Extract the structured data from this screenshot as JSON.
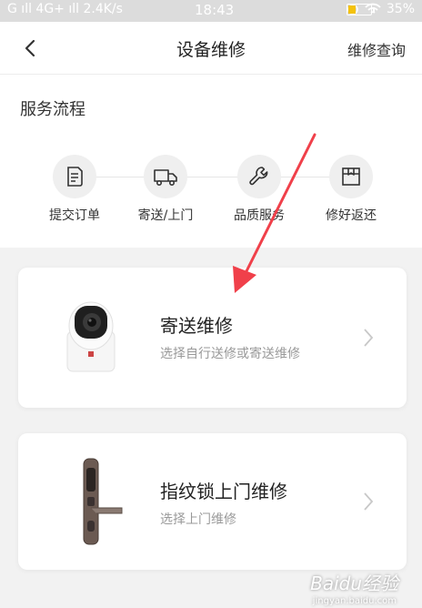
{
  "status_bar": {
    "left": "G ıll  4G+ ıll  2.4K/s",
    "time": "18:43",
    "battery": "35%",
    "battery_level": 0.35,
    "colors": {
      "battery_fill": "#f4c20d"
    }
  },
  "nav": {
    "title": "设备维修",
    "right_action": "维修查询",
    "back_icon": "chevron-left-icon"
  },
  "service_flow": {
    "title": "服务流程",
    "steps": [
      {
        "label": "提交订单",
        "icon": "document-icon"
      },
      {
        "label": "寄送/上门",
        "icon": "truck-icon"
      },
      {
        "label": "品质服务",
        "icon": "wrench-icon"
      },
      {
        "label": "修好返还",
        "icon": "package-icon"
      }
    ]
  },
  "options": [
    {
      "title": "寄送维修",
      "subtitle": "选择自行送修或寄送维修",
      "image": "camera-image"
    },
    {
      "title": "指纹锁上门维修",
      "subtitle": "选择上门维修",
      "image": "door-lock-image"
    }
  ],
  "annotation": {
    "color": "#f0404a"
  },
  "watermark": {
    "text": "Baidu经验",
    "sub": "jingyan.baidu.com"
  }
}
